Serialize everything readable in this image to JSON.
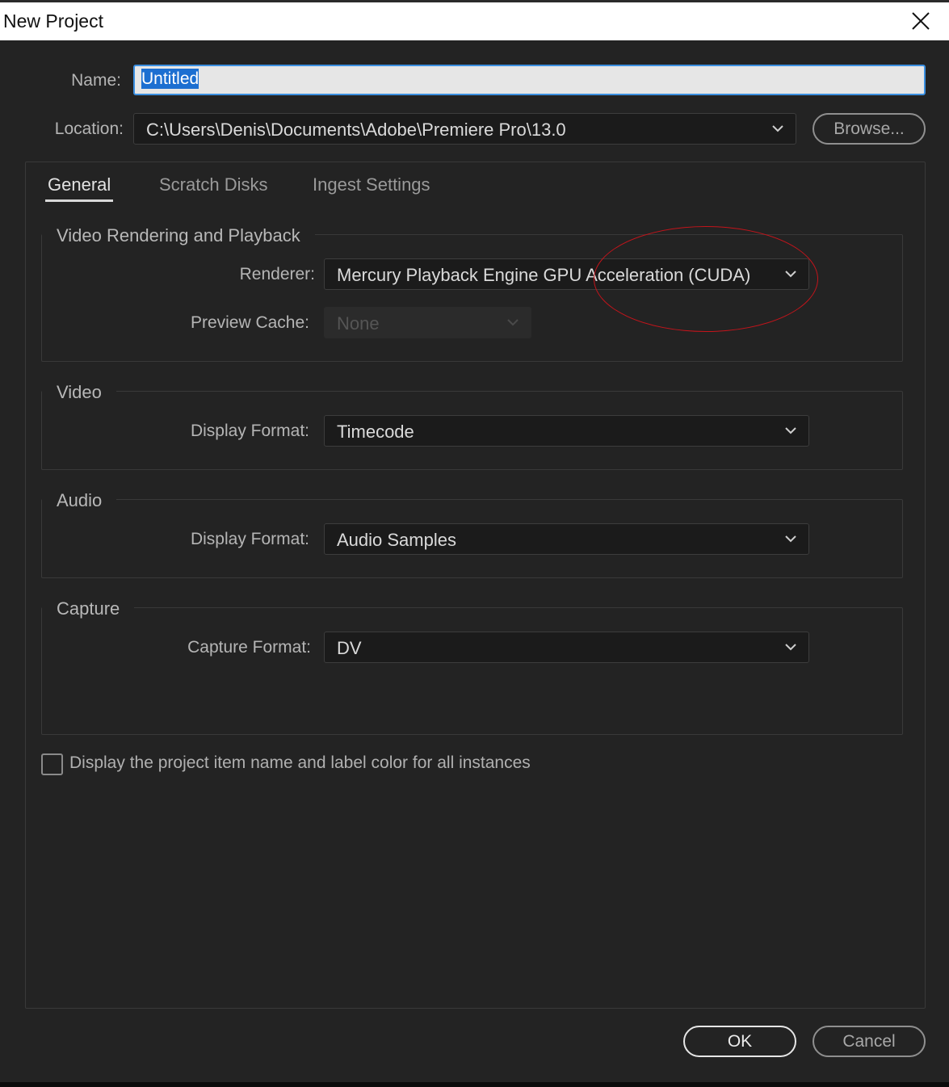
{
  "window": {
    "title": "New Project",
    "close_icon": "close-icon"
  },
  "name": {
    "label": "Name:",
    "value": "Untitled"
  },
  "location": {
    "label": "Location:",
    "value": "C:\\Users\\Denis\\Documents\\Adobe\\Premiere Pro\\13.0",
    "browse_label": "Browse..."
  },
  "tabs": [
    {
      "label": "General",
      "active": true
    },
    {
      "label": "Scratch Disks",
      "active": false
    },
    {
      "label": "Ingest Settings",
      "active": false
    }
  ],
  "groups": {
    "rendering": {
      "title": "Video Rendering and Playback",
      "renderer_label": "Renderer:",
      "renderer_value": "Mercury Playback Engine GPU Acceleration (CUDA)",
      "preview_cache_label": "Preview Cache:",
      "preview_cache_value": "None"
    },
    "video": {
      "title": "Video",
      "display_format_label": "Display Format:",
      "display_format_value": "Timecode"
    },
    "audio": {
      "title": "Audio",
      "display_format_label": "Display Format:",
      "display_format_value": "Audio Samples"
    },
    "capture": {
      "title": "Capture",
      "capture_format_label": "Capture Format:",
      "capture_format_value": "DV"
    }
  },
  "option": {
    "label": "Display the project item name and label color for all instances",
    "checked": false
  },
  "buttons": {
    "ok_label": "OK",
    "cancel_label": "Cancel"
  },
  "annotation_color": "#c4141b",
  "accent_color": "#1c6fd1"
}
